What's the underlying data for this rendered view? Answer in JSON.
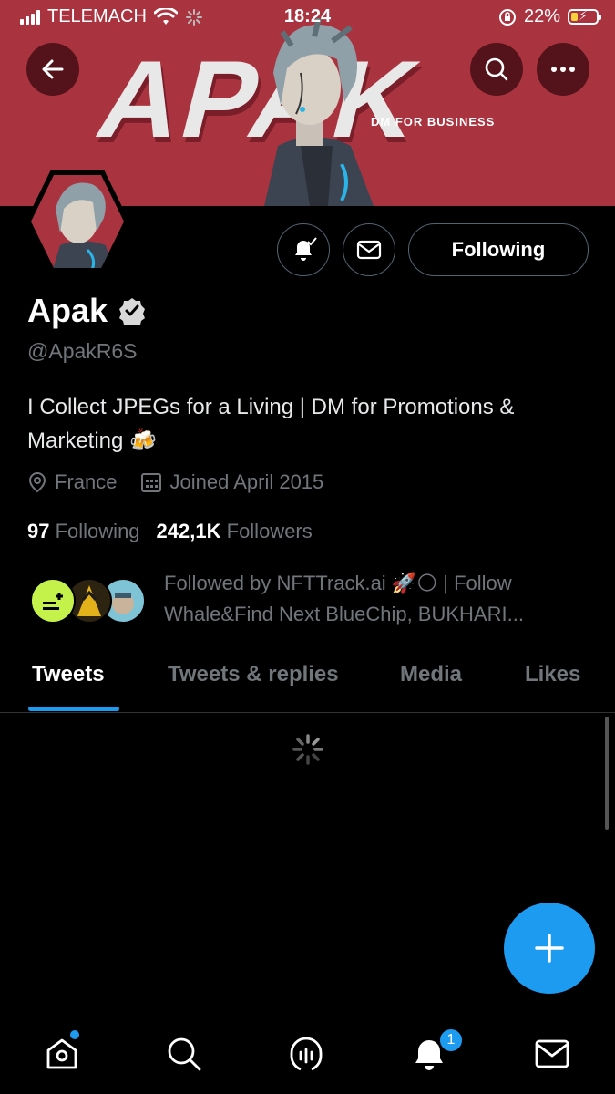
{
  "status_bar": {
    "carrier": "TELEMACH",
    "time": "18:24",
    "battery": "22%",
    "battery_level": 0.22
  },
  "banner": {
    "logo_text": "APAK",
    "tagline": "DM FOR BUSINESS",
    "color": "#a93440"
  },
  "header": {
    "back_icon": "arrow-left-icon",
    "search_icon": "search-icon",
    "more_icon": "more-horizontal-icon"
  },
  "profile": {
    "name": "Apak",
    "handle": "@ApakR6S",
    "bio": "I Collect JPEGs for a Living | DM for Promotions & Marketing 🍻",
    "location": "France",
    "joined": "Joined April 2015",
    "following_count": "97",
    "following_label": "Following",
    "followers_count": "242,1K",
    "followers_label": "Followers",
    "followed_by": "Followed by NFTTrack.ai 🚀🌕 | Follow Whale&Find Next BlueChip, BUKHARI..."
  },
  "actions": {
    "follow_button_label": "Following"
  },
  "tabs": [
    {
      "label": "Tweets",
      "active": true
    },
    {
      "label": "Tweets & replies",
      "active": false
    },
    {
      "label": "Media",
      "active": false
    },
    {
      "label": "Likes",
      "active": false
    }
  ],
  "bottom_nav": {
    "notifications_badge": "1"
  },
  "colors": {
    "accent": "#1d9bf0",
    "verified": "#d9d9d9"
  }
}
